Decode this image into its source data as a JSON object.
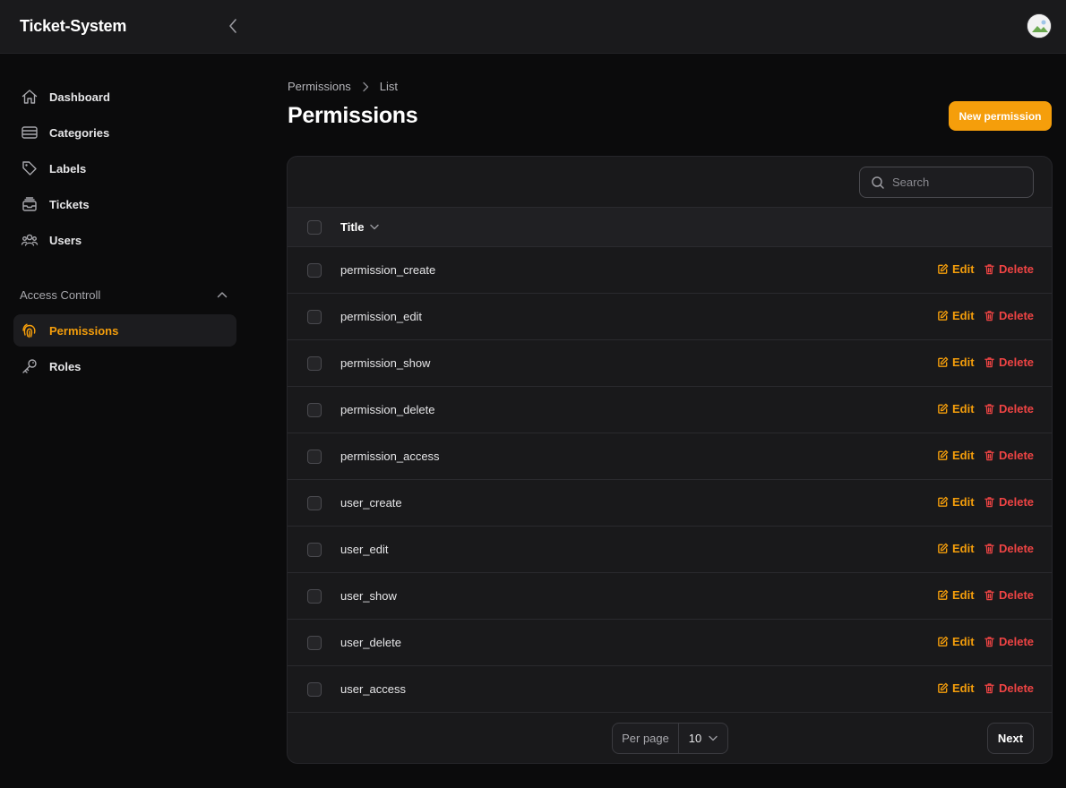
{
  "app": {
    "brand": "Ticket-System"
  },
  "sidebar": {
    "items": [
      {
        "label": "Dashboard",
        "icon": "home-icon"
      },
      {
        "label": "Categories",
        "icon": "stack-icon"
      },
      {
        "label": "Labels",
        "icon": "tag-icon"
      },
      {
        "label": "Tickets",
        "icon": "inbox-stack-icon"
      },
      {
        "label": "Users",
        "icon": "user-group-icon"
      }
    ],
    "group": {
      "label": "Access Controll",
      "items": [
        {
          "label": "Permissions",
          "icon": "fingerprint-icon",
          "active": true
        },
        {
          "label": "Roles",
          "icon": "key-icon",
          "active": false
        }
      ]
    }
  },
  "breadcrumb": {
    "items": [
      "Permissions",
      "List"
    ]
  },
  "page": {
    "title": "Permissions",
    "new_button": "New permission"
  },
  "table": {
    "search_placeholder": "Search",
    "column_title": "Title",
    "actions": {
      "edit": "Edit",
      "delete": "Delete"
    },
    "rows": [
      "permission_create",
      "permission_edit",
      "permission_show",
      "permission_delete",
      "permission_access",
      "user_create",
      "user_edit",
      "user_show",
      "user_delete",
      "user_access"
    ]
  },
  "pagination": {
    "per_page_label": "Per page",
    "per_page_value": "10",
    "next_label": "Next"
  },
  "colors": {
    "accent": "#f59e0b",
    "danger": "#ef4444",
    "background": "#0b0b0c",
    "card": "#19191b"
  }
}
